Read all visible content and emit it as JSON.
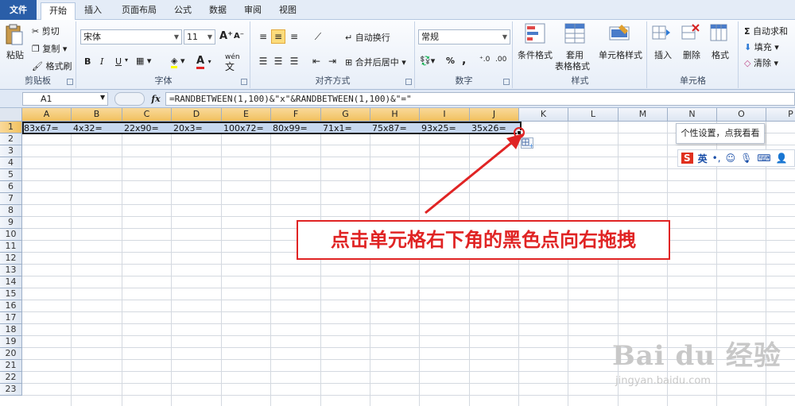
{
  "tabs": {
    "file": "文件",
    "home": "开始",
    "insert": "插入",
    "page_layout": "页面布局",
    "formulas": "公式",
    "data": "数据",
    "review": "审阅",
    "view": "视图"
  },
  "ribbon": {
    "clipboard": {
      "label": "剪贴板",
      "paste": "粘贴",
      "cut": "剪切",
      "copy": "复制",
      "format_painter": "格式刷"
    },
    "font": {
      "label": "字体",
      "family": "宋体",
      "size": "11",
      "grow": "A",
      "shrink": "A",
      "bold": "B",
      "italic": "I",
      "underline": "U",
      "color_letter": "A",
      "wen": "wén"
    },
    "alignment": {
      "label": "对齐方式",
      "wrap": "自动换行",
      "merge": "合并后居中"
    },
    "number": {
      "label": "数字",
      "format": "常规",
      "percent": "%",
      "comma": ","
    },
    "styles": {
      "label": "样式",
      "conditional": "条件格式",
      "table_line1": "套用",
      "table_line2": "表格格式",
      "cell_styles": "单元格样式"
    },
    "cells": {
      "label": "单元格",
      "insert": "插入",
      "delete": "删除",
      "format": "格式"
    },
    "editing": {
      "autosum": "自动求和",
      "fill": "填充",
      "clear": "清除"
    }
  },
  "formula_bar": {
    "name_box": "A1",
    "fx": "fx",
    "formula": "=RANDBETWEEN(1,100)&\"x\"&RANDBETWEEN(1,100)&\"=\""
  },
  "columns": [
    "A",
    "B",
    "C",
    "D",
    "E",
    "F",
    "G",
    "H",
    "I",
    "J",
    "K",
    "L",
    "M",
    "N",
    "O",
    "P"
  ],
  "rows": [
    "1",
    "2",
    "3",
    "4",
    "5",
    "6",
    "7",
    "8",
    "9",
    "10",
    "11",
    "12",
    "13",
    "14",
    "15",
    "16",
    "17",
    "18",
    "19",
    "20",
    "21",
    "22",
    "23"
  ],
  "row1_values": [
    "83x67=",
    "4x32=",
    "22x90=",
    "20x3=",
    "100x72=",
    "80x99=",
    "71x1=",
    "75x87=",
    "93x25=",
    "35x26="
  ],
  "annotation": "点击单元格右下角的黑色点向右拖拽",
  "tooltip": "个性设置，点我看看",
  "ime": {
    "logo": "S",
    "lang": "英"
  },
  "watermark": {
    "main": "Bai du 经验",
    "sub": "jingyan.baidu.com"
  },
  "colors": {
    "accent": "#2a5ea8",
    "annotation_red": "#e02424",
    "selection": "#c7d8ef"
  }
}
